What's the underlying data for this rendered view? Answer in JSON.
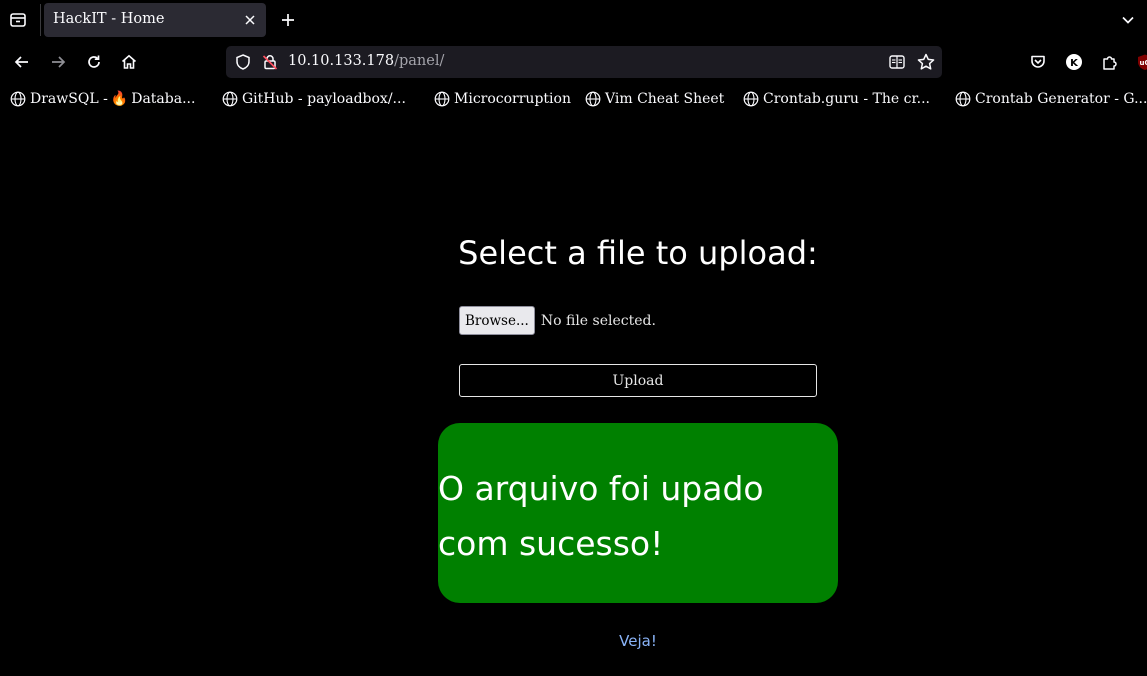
{
  "browser": {
    "tab": {
      "title": "HackIT - Home"
    },
    "url": {
      "host": "10.10.133.178",
      "path": "/panel/"
    },
    "icons": {
      "tab_list": "tab-list-icon",
      "tab_close": "close-icon",
      "new_tab": "plus-icon",
      "tabs_overflow": "chevron-down-icon",
      "back": "back-arrow-icon",
      "forward": "forward-arrow-icon",
      "reload": "reload-icon",
      "home": "home-icon",
      "tracking": "shield-icon",
      "insecure": "insecure-lock-icon",
      "reader": "reader-view-icon",
      "bookmark": "star-icon",
      "pocket": "pocket-icon",
      "account": "account-k-icon",
      "extensions": "puzzle-icon",
      "ublock": "ublock-icon"
    },
    "bookmarks": [
      {
        "prefix": "DrawSQL - ",
        "emoji": "🔥",
        "label": "Databa..."
      },
      {
        "label": "GitHub - payloadbox/..."
      },
      {
        "label": "Microcorruption"
      },
      {
        "label": "Vim Cheat Sheet"
      },
      {
        "label": "Crontab.guru - The cr..."
      },
      {
        "label": "Crontab Generator - G..."
      }
    ],
    "account_letter": "K"
  },
  "page": {
    "heading": "Select a file to upload:",
    "browse_label": "Browse...",
    "file_status": "No file selected.",
    "upload_label": "Upload",
    "success_message": "O arquivo foi upado com sucesso!",
    "link_label": "Veja!"
  },
  "colors": {
    "background": "#000000",
    "success_box": "#008000",
    "link": "#8ab4f8"
  }
}
